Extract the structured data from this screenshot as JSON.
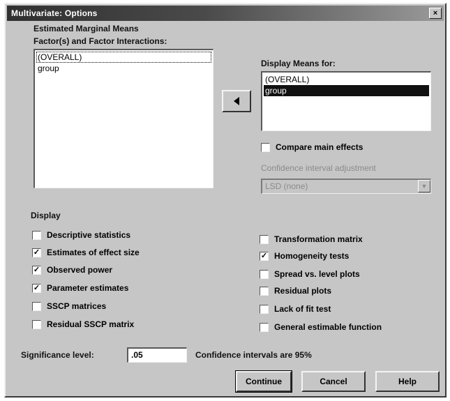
{
  "window": {
    "title": "Multivariate: Options",
    "close_glyph": "×"
  },
  "emm": {
    "group_label": "Estimated Marginal Means",
    "factors_label": "Factor(s) and Factor Interactions:",
    "factors": [
      "(OVERALL)",
      "group"
    ],
    "display_means_label": "Display Means for:",
    "display_means": [
      "(OVERALL)",
      "group"
    ],
    "compare_main_effects": "Compare main effects",
    "ci_adjust_label": "Confidence interval adjustment",
    "ci_adjust_value": "LSD (none)"
  },
  "display": {
    "group_label": "Display",
    "left": [
      {
        "label": "Descriptive statistics",
        "checked": false
      },
      {
        "label": "Estimates of effect size",
        "checked": true
      },
      {
        "label": "Observed power",
        "checked": true
      },
      {
        "label": "Parameter estimates",
        "checked": true
      },
      {
        "label": "SSCP matrices",
        "checked": false
      },
      {
        "label": "Residual SSCP matrix",
        "checked": false
      }
    ],
    "right": [
      {
        "label": "Transformation matrix",
        "checked": false
      },
      {
        "label": "Homogeneity tests",
        "checked": true
      },
      {
        "label": "Spread vs. level plots",
        "checked": false
      },
      {
        "label": "Residual plots",
        "checked": false
      },
      {
        "label": "Lack of fit test",
        "checked": false
      },
      {
        "label": "General estimable function",
        "checked": false
      }
    ]
  },
  "significance": {
    "label": "Significance level:",
    "value": ".05",
    "ci_note": "Confidence intervals are 95%"
  },
  "buttons": {
    "continue": "Continue",
    "cancel": "Cancel",
    "help": "Help"
  },
  "icons": {
    "move_arrow": "left-arrow-icon",
    "check": "✓"
  }
}
